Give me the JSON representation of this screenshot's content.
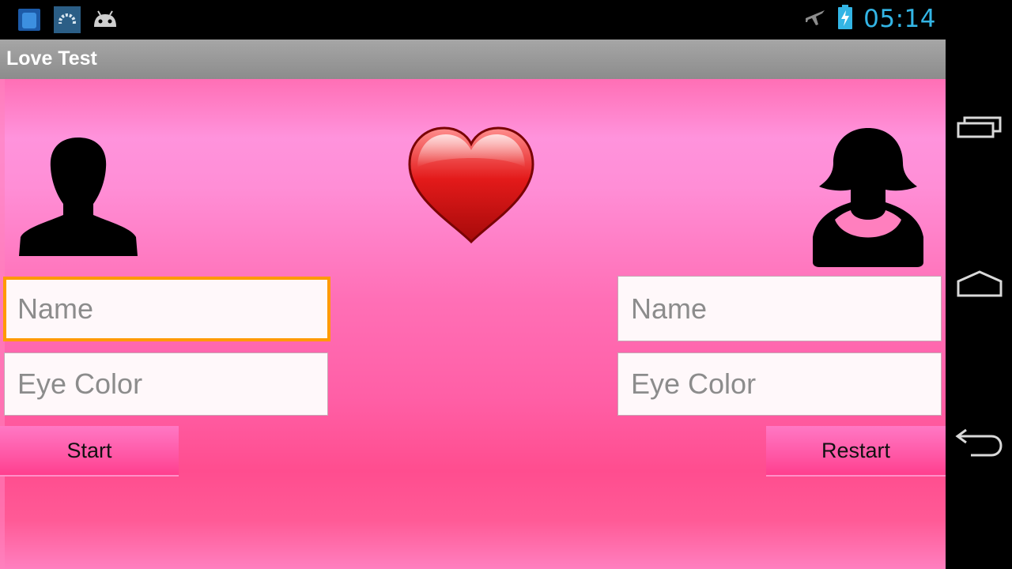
{
  "status_bar": {
    "time": "05:14",
    "time_color": "#33b5e5",
    "left_icons": [
      "app-notification-icon",
      "settings-notification-icon",
      "android-notification-icon"
    ],
    "right_icons": [
      "airplane-mode-icon",
      "battery-charging-icon"
    ]
  },
  "action_bar": {
    "title": "Love Test"
  },
  "left_person": {
    "avatar": "male-silhouette-icon",
    "name_placeholder": "Name",
    "eye_color_placeholder": "Eye Color"
  },
  "center": {
    "icon": "heart-icon"
  },
  "right_person": {
    "avatar": "female-silhouette-icon",
    "name_placeholder": "Name",
    "eye_color_placeholder": "Eye Color"
  },
  "buttons": {
    "start_label": "Start",
    "restart_label": "Restart"
  },
  "nav_bar": {
    "icons": [
      "recent-apps-icon",
      "home-icon",
      "back-icon"
    ]
  },
  "colors": {
    "accent_focus": "#ff9a00",
    "background_pink": "#ff6fb6"
  }
}
